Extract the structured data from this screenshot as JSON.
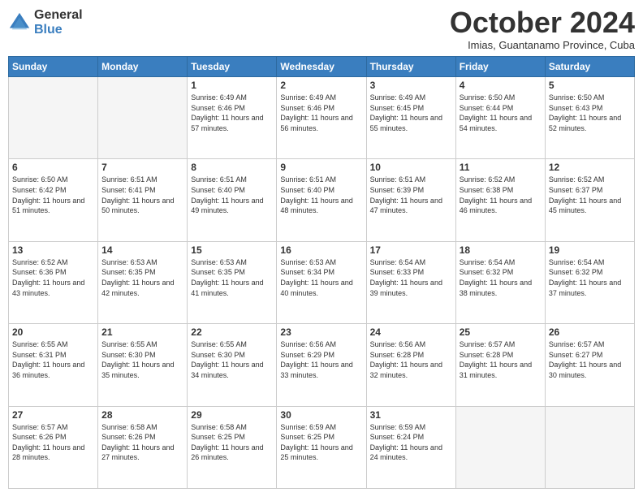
{
  "logo": {
    "general": "General",
    "blue": "Blue"
  },
  "header": {
    "month": "October 2024",
    "location": "Imias, Guantanamo Province, Cuba"
  },
  "days_of_week": [
    "Sunday",
    "Monday",
    "Tuesday",
    "Wednesday",
    "Thursday",
    "Friday",
    "Saturday"
  ],
  "weeks": [
    [
      {
        "day": "",
        "info": ""
      },
      {
        "day": "",
        "info": ""
      },
      {
        "day": "1",
        "info": "Sunrise: 6:49 AM\nSunset: 6:46 PM\nDaylight: 11 hours and 57 minutes."
      },
      {
        "day": "2",
        "info": "Sunrise: 6:49 AM\nSunset: 6:46 PM\nDaylight: 11 hours and 56 minutes."
      },
      {
        "day": "3",
        "info": "Sunrise: 6:49 AM\nSunset: 6:45 PM\nDaylight: 11 hours and 55 minutes."
      },
      {
        "day": "4",
        "info": "Sunrise: 6:50 AM\nSunset: 6:44 PM\nDaylight: 11 hours and 54 minutes."
      },
      {
        "day": "5",
        "info": "Sunrise: 6:50 AM\nSunset: 6:43 PM\nDaylight: 11 hours and 52 minutes."
      }
    ],
    [
      {
        "day": "6",
        "info": "Sunrise: 6:50 AM\nSunset: 6:42 PM\nDaylight: 11 hours and 51 minutes."
      },
      {
        "day": "7",
        "info": "Sunrise: 6:51 AM\nSunset: 6:41 PM\nDaylight: 11 hours and 50 minutes."
      },
      {
        "day": "8",
        "info": "Sunrise: 6:51 AM\nSunset: 6:40 PM\nDaylight: 11 hours and 49 minutes."
      },
      {
        "day": "9",
        "info": "Sunrise: 6:51 AM\nSunset: 6:40 PM\nDaylight: 11 hours and 48 minutes."
      },
      {
        "day": "10",
        "info": "Sunrise: 6:51 AM\nSunset: 6:39 PM\nDaylight: 11 hours and 47 minutes."
      },
      {
        "day": "11",
        "info": "Sunrise: 6:52 AM\nSunset: 6:38 PM\nDaylight: 11 hours and 46 minutes."
      },
      {
        "day": "12",
        "info": "Sunrise: 6:52 AM\nSunset: 6:37 PM\nDaylight: 11 hours and 45 minutes."
      }
    ],
    [
      {
        "day": "13",
        "info": "Sunrise: 6:52 AM\nSunset: 6:36 PM\nDaylight: 11 hours and 43 minutes."
      },
      {
        "day": "14",
        "info": "Sunrise: 6:53 AM\nSunset: 6:35 PM\nDaylight: 11 hours and 42 minutes."
      },
      {
        "day": "15",
        "info": "Sunrise: 6:53 AM\nSunset: 6:35 PM\nDaylight: 11 hours and 41 minutes."
      },
      {
        "day": "16",
        "info": "Sunrise: 6:53 AM\nSunset: 6:34 PM\nDaylight: 11 hours and 40 minutes."
      },
      {
        "day": "17",
        "info": "Sunrise: 6:54 AM\nSunset: 6:33 PM\nDaylight: 11 hours and 39 minutes."
      },
      {
        "day": "18",
        "info": "Sunrise: 6:54 AM\nSunset: 6:32 PM\nDaylight: 11 hours and 38 minutes."
      },
      {
        "day": "19",
        "info": "Sunrise: 6:54 AM\nSunset: 6:32 PM\nDaylight: 11 hours and 37 minutes."
      }
    ],
    [
      {
        "day": "20",
        "info": "Sunrise: 6:55 AM\nSunset: 6:31 PM\nDaylight: 11 hours and 36 minutes."
      },
      {
        "day": "21",
        "info": "Sunrise: 6:55 AM\nSunset: 6:30 PM\nDaylight: 11 hours and 35 minutes."
      },
      {
        "day": "22",
        "info": "Sunrise: 6:55 AM\nSunset: 6:30 PM\nDaylight: 11 hours and 34 minutes."
      },
      {
        "day": "23",
        "info": "Sunrise: 6:56 AM\nSunset: 6:29 PM\nDaylight: 11 hours and 33 minutes."
      },
      {
        "day": "24",
        "info": "Sunrise: 6:56 AM\nSunset: 6:28 PM\nDaylight: 11 hours and 32 minutes."
      },
      {
        "day": "25",
        "info": "Sunrise: 6:57 AM\nSunset: 6:28 PM\nDaylight: 11 hours and 31 minutes."
      },
      {
        "day": "26",
        "info": "Sunrise: 6:57 AM\nSunset: 6:27 PM\nDaylight: 11 hours and 30 minutes."
      }
    ],
    [
      {
        "day": "27",
        "info": "Sunrise: 6:57 AM\nSunset: 6:26 PM\nDaylight: 11 hours and 28 minutes."
      },
      {
        "day": "28",
        "info": "Sunrise: 6:58 AM\nSunset: 6:26 PM\nDaylight: 11 hours and 27 minutes."
      },
      {
        "day": "29",
        "info": "Sunrise: 6:58 AM\nSunset: 6:25 PM\nDaylight: 11 hours and 26 minutes."
      },
      {
        "day": "30",
        "info": "Sunrise: 6:59 AM\nSunset: 6:25 PM\nDaylight: 11 hours and 25 minutes."
      },
      {
        "day": "31",
        "info": "Sunrise: 6:59 AM\nSunset: 6:24 PM\nDaylight: 11 hours and 24 minutes."
      },
      {
        "day": "",
        "info": ""
      },
      {
        "day": "",
        "info": ""
      }
    ]
  ]
}
